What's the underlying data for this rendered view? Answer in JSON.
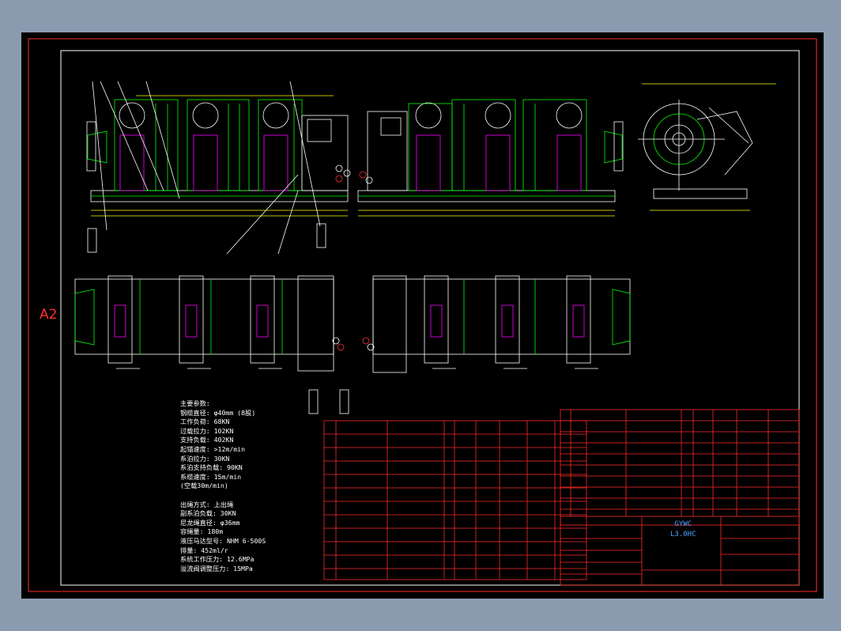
{
  "sheet": {
    "size_mark": "A2"
  },
  "colors": {
    "frame": "#ff3030",
    "table": "#ff2a2a",
    "outline": "#ffffff",
    "detail": "#00ff00",
    "dims": "#ffff00",
    "title": "#4aa3ff",
    "accent": "#ff00ff"
  },
  "parameters": {
    "lines": [
      "主要参数:",
      "钢缆直径: φ40mm (8股)",
      "工作负荷: 68KN",
      "过载拉力: 102KN",
      "支持负载: 402KN",
      "起锚速度: >12m/min",
      "系泊拉力: 30KN",
      "系泊支持负载: 90KN",
      "系缆速度: 15m/min",
      "(空载30m/min)",
      "",
      "出绳方式: 上出绳",
      "副系泊负载: 30KN",
      "尼龙绳直径: φ36mm",
      "容绳量: 180m",
      "液压马达型号: NHM 6-500S",
      "排量: 452ml/r",
      "系统工作压力: 12.6MPa",
      "溢流阀调整压力: 15MPa"
    ]
  },
  "title_block": {
    "line1": "GYWC",
    "line2": "L3.0HC"
  }
}
